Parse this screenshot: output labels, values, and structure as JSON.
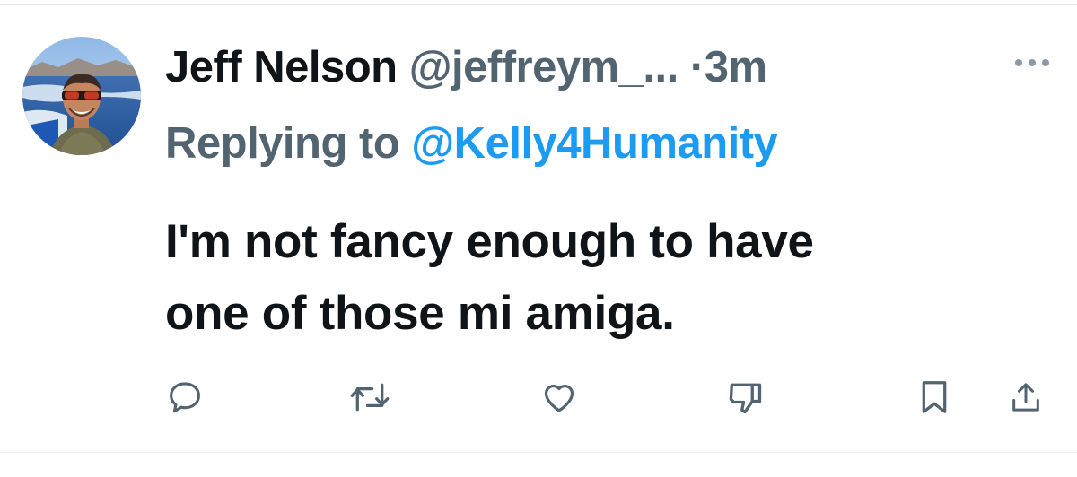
{
  "tweet": {
    "author_name": "Jeff Nelson",
    "author_handle": "@jeffreym_...",
    "separator": "·",
    "timestamp": "3m",
    "reply_prefix": "Replying to",
    "reply_to_handle": "@Kelly4Humanity",
    "text_line_1": "I'm not fancy enough to have",
    "text_line_2": "one of those mi amiga."
  },
  "actions": {
    "icons": [
      "reply-icon",
      "retweet-icon",
      "like-icon",
      "dislike-icon",
      "bookmark-icon",
      "share-icon"
    ]
  },
  "colors": {
    "text_primary": "#0f1419",
    "text_secondary": "#536471",
    "mention": "#1d9bf0",
    "divider": "#e7e9ea"
  }
}
